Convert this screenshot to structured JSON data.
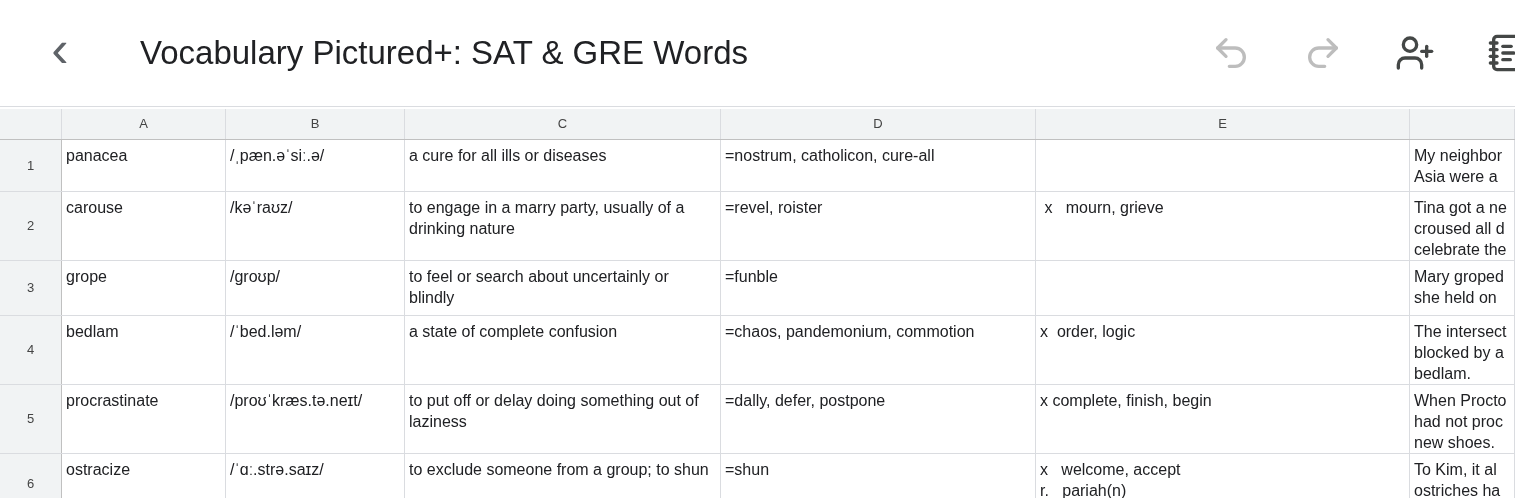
{
  "app_bar": {
    "back": "‹",
    "title": "Vocabulary Pictured+: SAT & GRE Words",
    "actions": [
      {
        "kind": "undo",
        "disabled": true
      },
      {
        "kind": "redo",
        "disabled": true
      },
      {
        "kind": "share",
        "disabled": false
      },
      {
        "kind": "notes",
        "disabled": false
      }
    ]
  },
  "sheet": {
    "columns": [
      "A",
      "B",
      "C",
      "D",
      "E",
      ""
    ],
    "rows": [
      {
        "number": "1",
        "cells": [
          "panacea",
          "/ˌpæn.əˈsiː.ə/",
          "a cure for all ills or diseases",
          "=nostrum, catholicon, cure-all",
          "",
          "My neighbor\nAsia were a"
        ]
      },
      {
        "number": "2",
        "cells": [
          "carouse",
          "/kəˈraʊz/",
          "to engage in a marry party, usually of a drinking nature",
          "=revel, roister",
          " x   mourn, grieve",
          "Tina got a ne\ncroused all d\ncelebrate the"
        ]
      },
      {
        "number": "3",
        "cells": [
          "grope",
          "/groʊp/",
          "to feel or search about uncertainly or blindly",
          "=funble",
          "",
          "Mary groped\nshe held on"
        ]
      },
      {
        "number": "4",
        "cells": [
          "bedlam",
          "/ˈbed.ləm/",
          "a state of complete confusion",
          "=chaos, pandemonium, commotion",
          "x  order, logic",
          "The intersect\nblocked by a\nbedlam."
        ]
      },
      {
        "number": "5",
        "cells": [
          "procrastinate",
          "/proʊˈkræs.tə.neɪt/",
          "to put off or delay doing something out of laziness",
          "=dally, defer, postpone",
          "x complete, finish, begin",
          "When Procto\nhad not proc\nnew shoes."
        ]
      },
      {
        "number": "6",
        "cells": [
          "ostracize",
          "/ˈɑː.strə.saɪz/",
          "to exclude someone from a group; to shun",
          "=shun",
          "x   welcome, accept\nr.   pariah(n)",
          "To Kim, it al\nostriches ha"
        ]
      }
    ]
  }
}
